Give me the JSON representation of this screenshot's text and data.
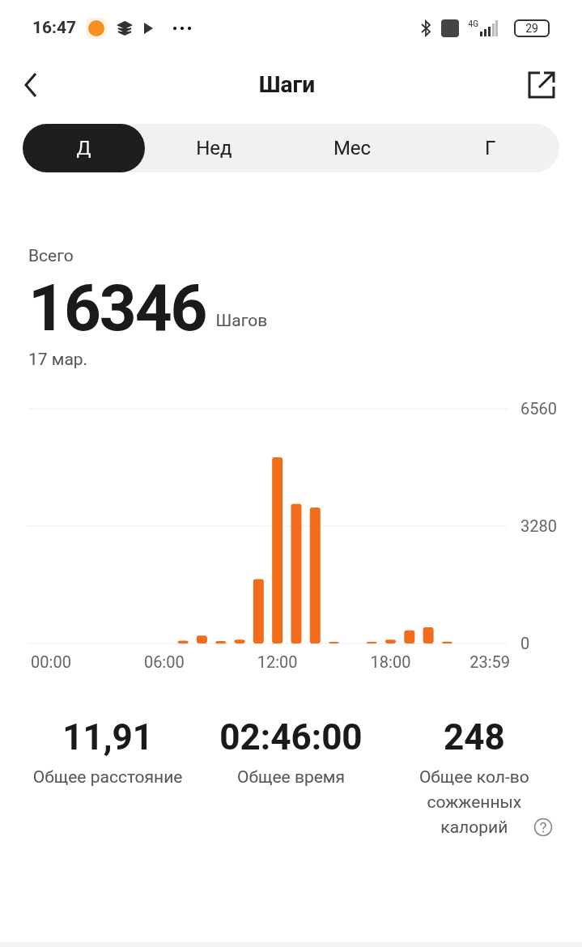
{
  "status_bar": {
    "time": "16:47",
    "network": "4G",
    "battery": "29"
  },
  "header": {
    "title": "Шаги"
  },
  "tabs": [
    {
      "label": "Д",
      "selected": true
    },
    {
      "label": "Нед",
      "selected": false
    },
    {
      "label": "Мес",
      "selected": false
    },
    {
      "label": "Г",
      "selected": false
    }
  ],
  "summary": {
    "label": "Всего",
    "value": "16346",
    "unit": "Шагов",
    "date": "17 мар."
  },
  "chart_data": {
    "type": "bar",
    "x": [
      7,
      8,
      9,
      10,
      11,
      12,
      13,
      14,
      15,
      17,
      18,
      19,
      20,
      21
    ],
    "series": [
      {
        "color": "#f26c1c",
        "values": [
          80,
          220,
          70,
          110,
          1800,
          5200,
          3900,
          3800,
          20,
          30,
          110,
          370,
          450,
          50
        ]
      }
    ],
    "xlim": [
      -1.2,
      24.2
    ],
    "ylim": [
      0,
      6560
    ],
    "xticks": [
      {
        "value": 0,
        "label": "00:00"
      },
      {
        "value": 6,
        "label": "06:00"
      },
      {
        "value": 12,
        "label": "12:00"
      },
      {
        "value": 18,
        "label": "18:00"
      },
      {
        "value": 23.98,
        "label": "23:59"
      }
    ],
    "yticks": [
      0,
      3280,
      6560
    ]
  },
  "stats": [
    {
      "value": "11,91",
      "label": "Общее расстояние",
      "help": false
    },
    {
      "value": "02:46:00",
      "label": "Общее время",
      "help": false
    },
    {
      "value": "248",
      "label": "Общее кол-во сожженных калорий",
      "help": true
    }
  ]
}
